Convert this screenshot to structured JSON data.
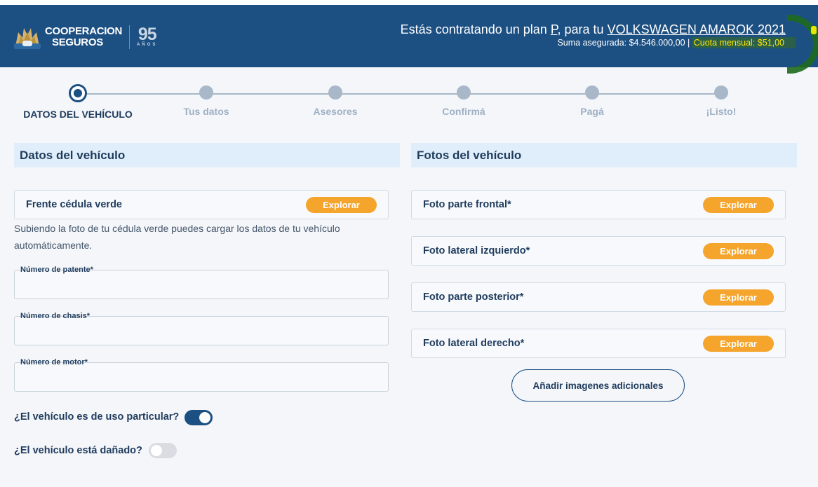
{
  "header": {
    "logo_line1": "COOPERACION",
    "logo_line2": "SEGUROS",
    "logo_years": "95",
    "logo_years_sub": "AÑOS",
    "title_prefix": "Estás contratando un plan ",
    "plan": "P",
    "title_mid": ", para tu ",
    "vehicle": "VOLKSWAGEN AMAROK 2021",
    "sum_insured": "Suma asegurada: $4.546.000,00",
    "separator": " | ",
    "monthly_fee": "Cuota mensual: $51,00"
  },
  "steps": [
    {
      "label": "DATOS DEL VEHÍCULO",
      "state": "active"
    },
    {
      "label": "Tus datos",
      "state": "pending"
    },
    {
      "label": "Asesores",
      "state": "pending"
    },
    {
      "label": "Confirmá",
      "state": "pending"
    },
    {
      "label": "Pagá",
      "state": "pending"
    },
    {
      "label": "¡Listo!",
      "state": "pending"
    }
  ],
  "vehicle_data": {
    "title": "Datos del vehículo",
    "green_card_label": "Frente cédula verde",
    "explore_label": "Explorar",
    "helper_text": "Subiendo la foto de tu cédula verde puedes cargar los datos de tu vehículo automáticamente.",
    "fields": {
      "plate": {
        "label": "Número de patente*",
        "value": ""
      },
      "chassis": {
        "label": "Número de chasis*",
        "value": ""
      },
      "engine": {
        "label": "Número de motor*",
        "value": ""
      }
    },
    "private_use": {
      "label": "¿El vehículo es de uso particular?",
      "on": true
    },
    "damaged": {
      "label": "¿El vehículo está dañado?",
      "on": false
    }
  },
  "photos": {
    "title": "Fotos del vehículo",
    "items": [
      {
        "label": "Foto parte frontal*",
        "button": "Explorar"
      },
      {
        "label": "Foto lateral izquierdo*",
        "button": "Explorar"
      },
      {
        "label": "Foto parte posterior*",
        "button": "Explorar"
      },
      {
        "label": "Foto lateral derecho*",
        "button": "Explorar"
      }
    ],
    "add_more_label": "Añadir imagenes adicionales"
  },
  "colors": {
    "header_bg": "#1c4f82",
    "accent_orange": "#f5a42c",
    "section_bg": "#dfeefa",
    "highlight_text": "#ffea00"
  }
}
